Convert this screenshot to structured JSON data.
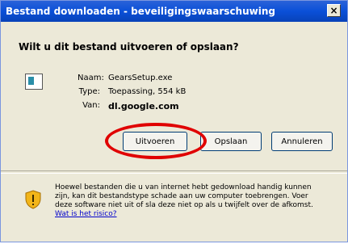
{
  "window": {
    "title": "Bestand downloaden - beveiligingswaarschuwing",
    "close_label": "×"
  },
  "dialog": {
    "heading": "Wilt u dit bestand uitvoeren of opslaan?",
    "file": {
      "name_label": "Naam:",
      "name_value": "GearsSetup.exe",
      "type_label": "Type:",
      "type_value": "Toepassing, 554 kB",
      "from_label": "Van:",
      "from_value": "dl.google.com"
    },
    "buttons": {
      "run": "Uitvoeren",
      "save": "Opslaan",
      "cancel": "Annuleren"
    },
    "warning": {
      "text": "Hoewel bestanden die u van internet hebt gedownload handig kunnen zijn, kan dit bestandstype schade aan uw computer toebrengen. Voer deze software niet uit of sla deze niet op als u twijfelt over de afkomst.",
      "link": "Wat is het risico?"
    }
  }
}
